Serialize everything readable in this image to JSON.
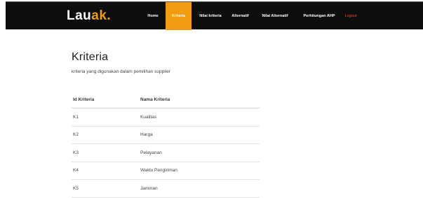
{
  "brand": {
    "part1": "Lau",
    "part2": "ak",
    "part3": "."
  },
  "nav": {
    "items": [
      {
        "label": "Home"
      },
      {
        "label": "Kriteria"
      },
      {
        "label": "Nilai kriteria"
      },
      {
        "label": "Alternatif"
      },
      {
        "label": "Nilai Alternatif"
      },
      {
        "label": "Perhitungan AHP"
      },
      {
        "label": "Logout"
      }
    ],
    "active": "Kriteria"
  },
  "page": {
    "title": "Kriteria",
    "subtitle": "kriteria yang digunakan dalam pemilihan supplier"
  },
  "table": {
    "headers": [
      "Id Kriteria",
      "Nama Kriteria"
    ],
    "rows": [
      [
        "K1",
        "Kualitas"
      ],
      [
        "K2",
        "Harga"
      ],
      [
        "K3",
        "Pelayanan"
      ],
      [
        "K4",
        "Waktu Pengiriman"
      ],
      [
        "K5",
        "Jaminan"
      ]
    ]
  },
  "colors": {
    "accent": "#f39c12",
    "navbar": "#0d0d0d",
    "logout": "#e74c3c"
  }
}
